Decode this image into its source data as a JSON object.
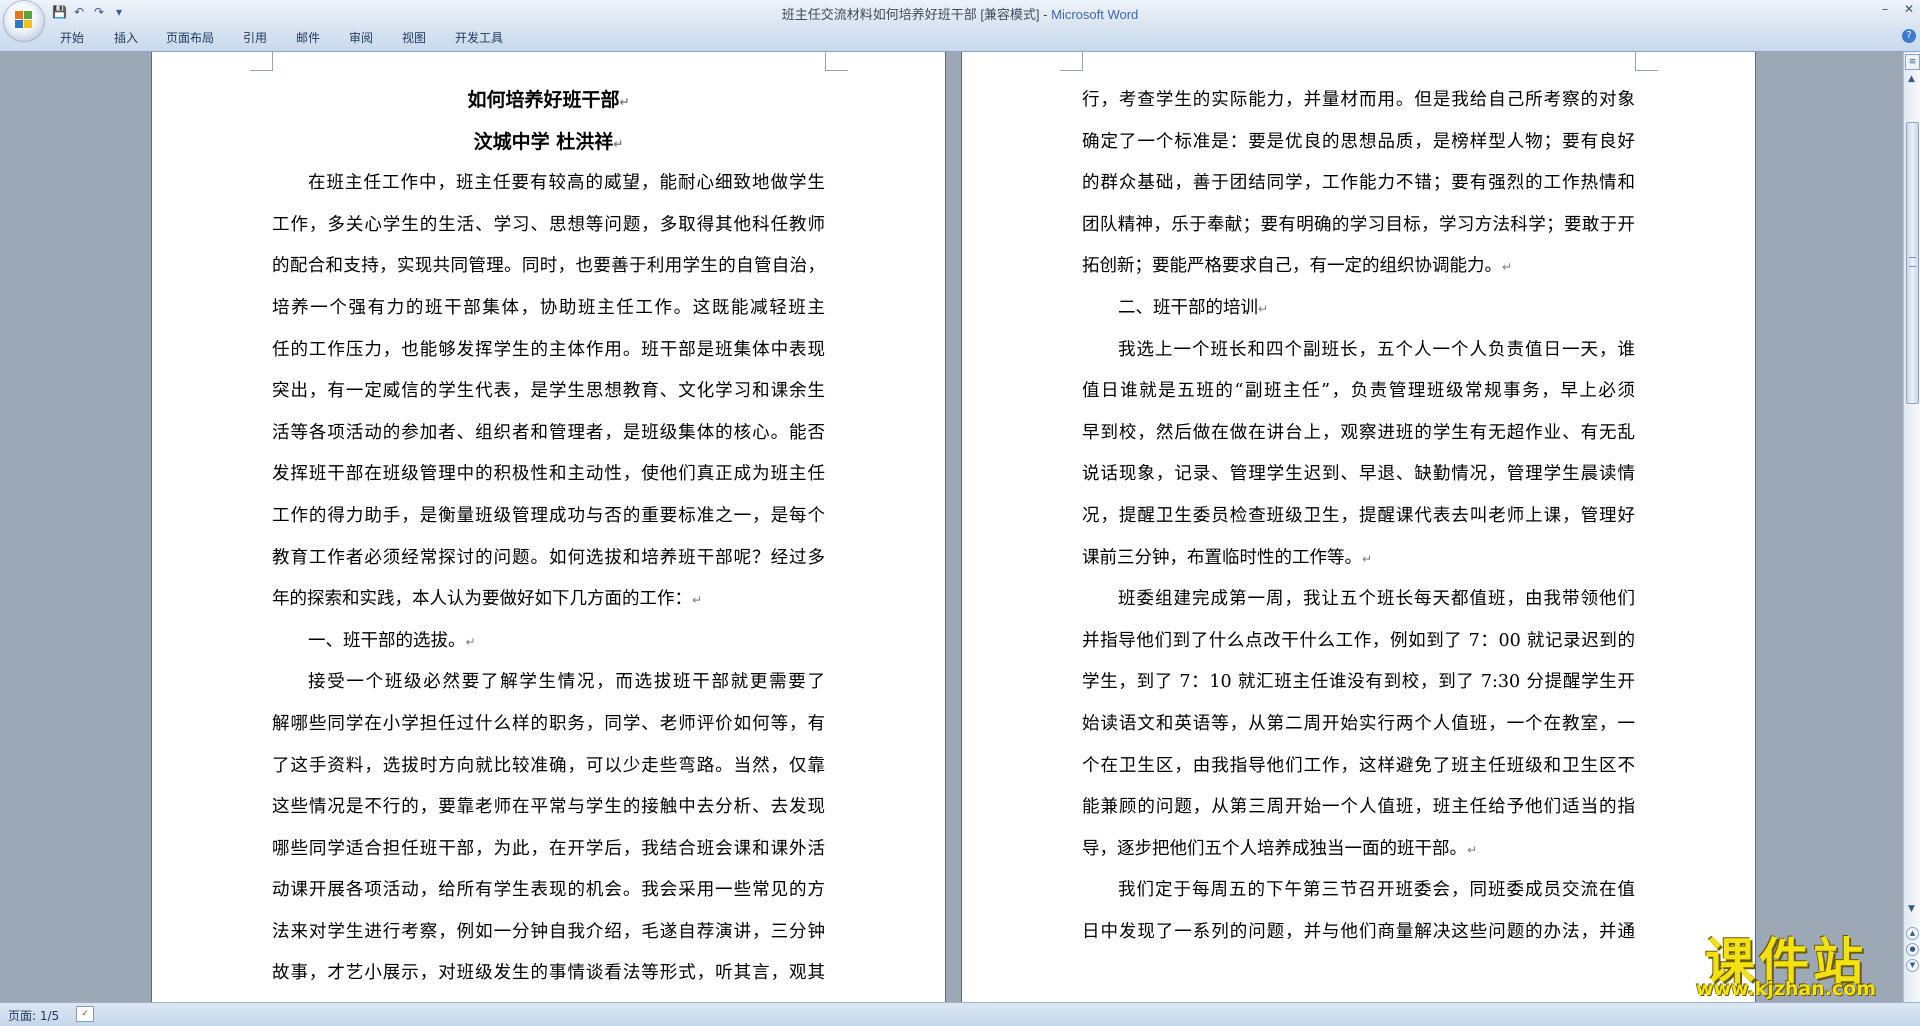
{
  "window": {
    "doc_title": "班主任交流材料如何培养好班干部 [兼容模式]",
    "title_separator": " - ",
    "app_name": "Microsoft Word"
  },
  "ribbon": {
    "tabs": [
      "开始",
      "插入",
      "页面布局",
      "引用",
      "邮件",
      "审阅",
      "视图",
      "开发工具"
    ]
  },
  "status": {
    "page_indicator": "页面: 1/5"
  },
  "page1": {
    "lines": [
      "如何培养好班干部",
      "汶城中学  杜洪祥",
      "在班主任工作中，班主任要有较高的威望，能耐心细致地做学生",
      "工作，多关心学生的生活、学习、思想等问题，多取得其他科任教师",
      "的配合和支持，实现共同管理。同时，也要善于利用学生的自管自治，",
      "培养一个强有力的班干部集体，协助班主任工作。这既能减轻班主",
      "任的工作压力，也能够发挥学生的主体作用。班干部是班集体中表现",
      "突出，有一定威信的学生代表，是学生思想教育、文化学习和课余生",
      "活等各项活动的参加者、组织者和管理者，是班级集体的核心。能否",
      "发挥班干部在班级管理中的积极性和主动性，使他们真正成为班主任",
      "工作的得力助手，是衡量班级管理成功与否的重要标准之一，是每个",
      "教育工作者必须经常探讨的问题。如何选拔和培养班干部呢？经过多",
      "年的探索和实践，本人认为要做好如下几方面的工作：",
      "一、班干部的选拔。",
      "接受一个班级必然要了解学生情况，而选拔班干部就更需要了",
      "解哪些同学在小学担任过什么样的职务，同学、老师评价如何等，有",
      "了这手资料，选拔时方向就比较准确，可以少走些弯路。当然，仅靠",
      "这些情况是不行的，要靠老师在平常与学生的接触中去分析、去发现",
      "哪些同学适合担任班干部，为此，在开学后，我结合班会课和课外活",
      "动课开展各项活动，给所有学生表现的机会。我会采用一些常见的方",
      "法来对学生进行考察，例如一分钟自我介绍，毛遂自荐演讲，三分钟",
      "故事，才艺小展示，对班级发生的事情谈看法等形式，听其言，观其"
    ]
  },
  "page2": {
    "lines": [
      "行，考查学生的实际能力，并量材而用。但是我给自己所考察的对象",
      "确定了一个标准是：要是优良的思想品质，是榜样型人物；要有良好",
      "的群众基础，善于团结同学，工作能力不错；要有强烈的工作热情和",
      "团队精神，乐于奉献；要有明确的学习目标，学习方法科学；要敢于开",
      "拓创新；要能严格要求自己，有一定的组织协调能力。",
      "二、班干部的培训",
      "我选上一个班长和四个副班长，五个人一个人负责值日一天，谁",
      "值日谁就是五班的“副班主任”，负责管理班级常规事务，早上必须",
      "早到校，然后做在做在讲台上，观察进班的学生有无超作业、有无乱",
      "说话现象，记录、管理学生迟到、早退、缺勤情况，管理学生晨读情",
      "况，提醒卫生委员检查班级卫生，提醒课代表去叫老师上课，管理好",
      "课前三分钟，布置临时性的工作等。",
      "班委组建完成第一周，我让五个班长每天都值班，由我带领他们",
      "并指导他们到了什么点改干什么工作，例如到了 7：00 就记录迟到的",
      "学生，到了 7：10 就汇班主任谁没有到校，到了 7:30 分提醒学生开",
      "始读语文和英语等，从第二周开始实行两个人值班，一个在教室，一",
      "个在卫生区，由我指导他们工作，这样避免了班主任班级和卫生区不",
      "能兼顾的问题，从第三周开始一个人值班，班主任给予他们适当的指",
      "导，逐步把他们五个人培养成独当一面的班干部。",
      "我们定于每周五的下午第三节召开班委会，同班委成员交流在值",
      "日中发现了一系列的问题，并与他们商量解决这些问题的办法，并通"
    ]
  },
  "watermark": {
    "main": "课件站",
    "url": "www.kjzhan.com"
  },
  "icons": [
    "office-button",
    "save-icon",
    "undo-icon",
    "redo-icon",
    "customize-qat-icon",
    "minimize-icon",
    "close-icon",
    "help-icon",
    "ruler-toggle-icon",
    "scroll-up-icon",
    "scroll-down-icon",
    "proofing-icon",
    "paragraph-mark-icon"
  ]
}
